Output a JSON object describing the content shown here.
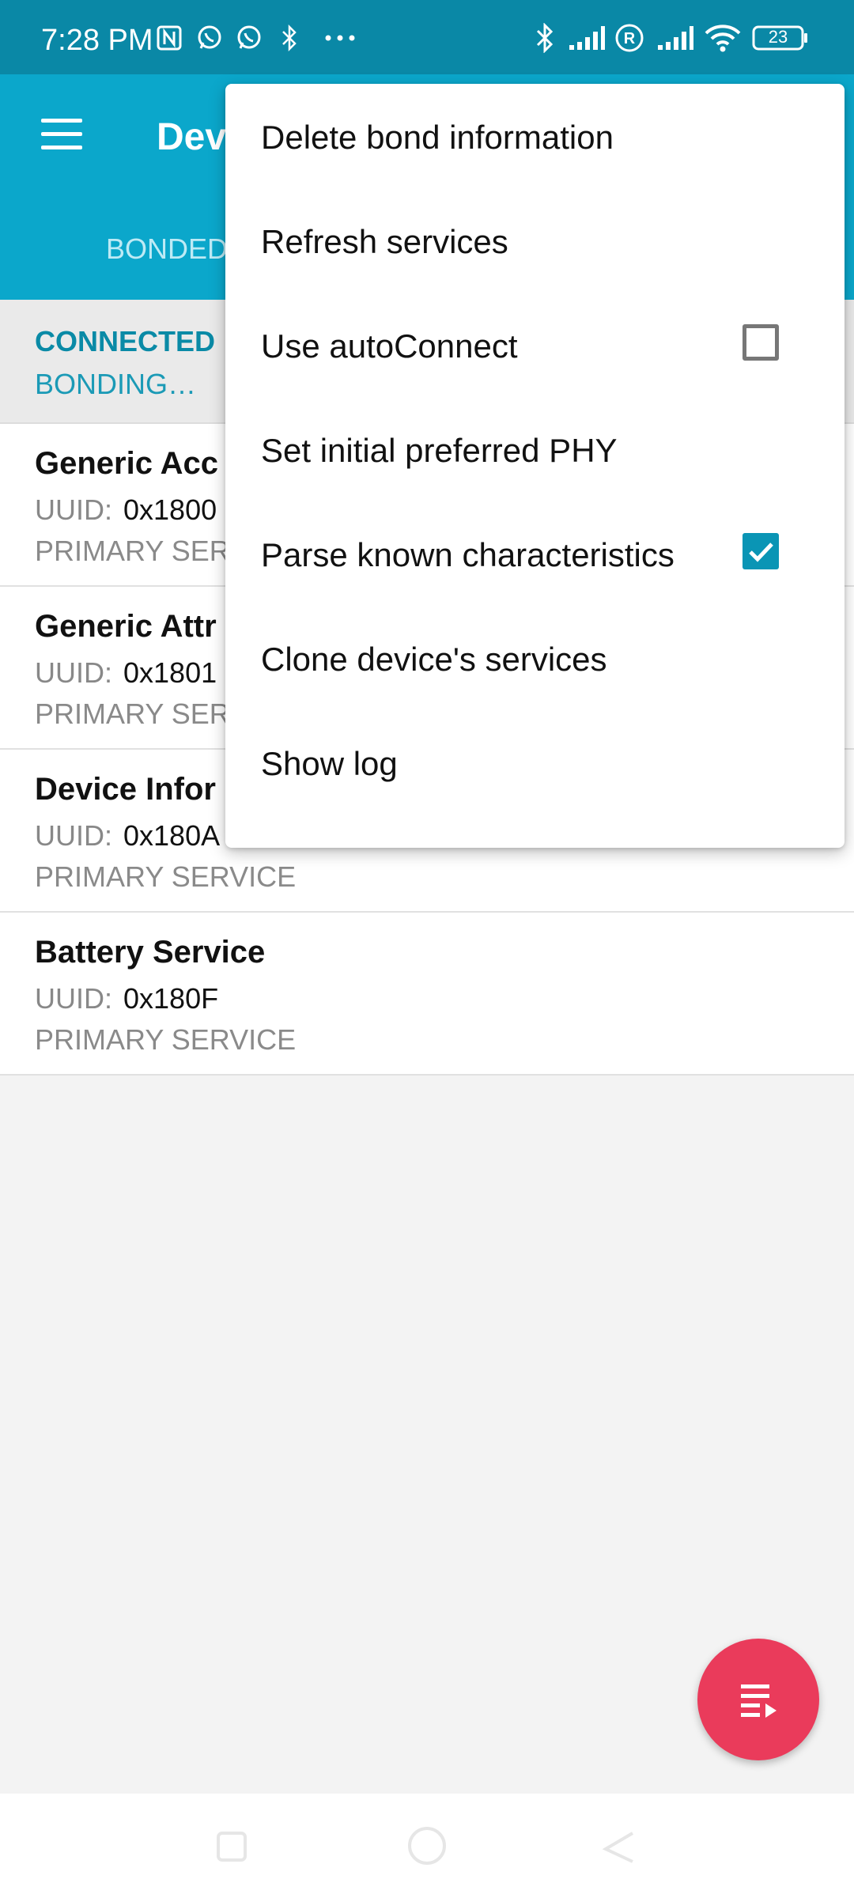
{
  "status_bar": {
    "time": "7:28 PM",
    "icons_left": [
      "nfc-icon",
      "whatsapp-icon",
      "whatsapp-icon",
      "bluetooth-icon",
      "more-dots-icon"
    ],
    "icons_right": [
      "bluetooth-icon",
      "signal-icon",
      "roaming-icon",
      "signal-icon",
      "wifi-icon",
      "battery-icon"
    ],
    "battery": "23"
  },
  "app_bar": {
    "title": "Dev",
    "tab": "BONDED"
  },
  "connection": {
    "state": "CONNECTED",
    "bond_state": "BONDING…"
  },
  "services": [
    {
      "name": "Generic Acc",
      "uuid_label": "UUID:",
      "uuid": "0x1800",
      "type": "PRIMARY SER"
    },
    {
      "name": "Generic Attr",
      "uuid_label": "UUID:",
      "uuid": "0x1801",
      "type": "PRIMARY SER"
    },
    {
      "name": "Device Infor",
      "uuid_label": "UUID:",
      "uuid": "0x180A",
      "type": "PRIMARY SERVICE"
    },
    {
      "name": "Battery Service",
      "uuid_label": "UUID:",
      "uuid": "0x180F",
      "type": "PRIMARY SERVICE"
    }
  ],
  "menu": {
    "items": [
      {
        "label": "Delete bond information",
        "checkbox": null
      },
      {
        "label": "Refresh services",
        "checkbox": null
      },
      {
        "label": "Use autoConnect",
        "checkbox": false
      },
      {
        "label": "Set initial preferred PHY",
        "checkbox": null
      },
      {
        "label": "Parse known characteristics",
        "checkbox": true
      },
      {
        "label": "Clone device's services",
        "checkbox": null
      },
      {
        "label": "Show log",
        "checkbox": null
      }
    ]
  },
  "fab": {
    "icon": "log-list-icon"
  },
  "colors": {
    "status_bar": "#0a88a6",
    "app_bar": "#0ba7cb",
    "accent": "#0a95b5",
    "fab": "#ea3b5b"
  }
}
